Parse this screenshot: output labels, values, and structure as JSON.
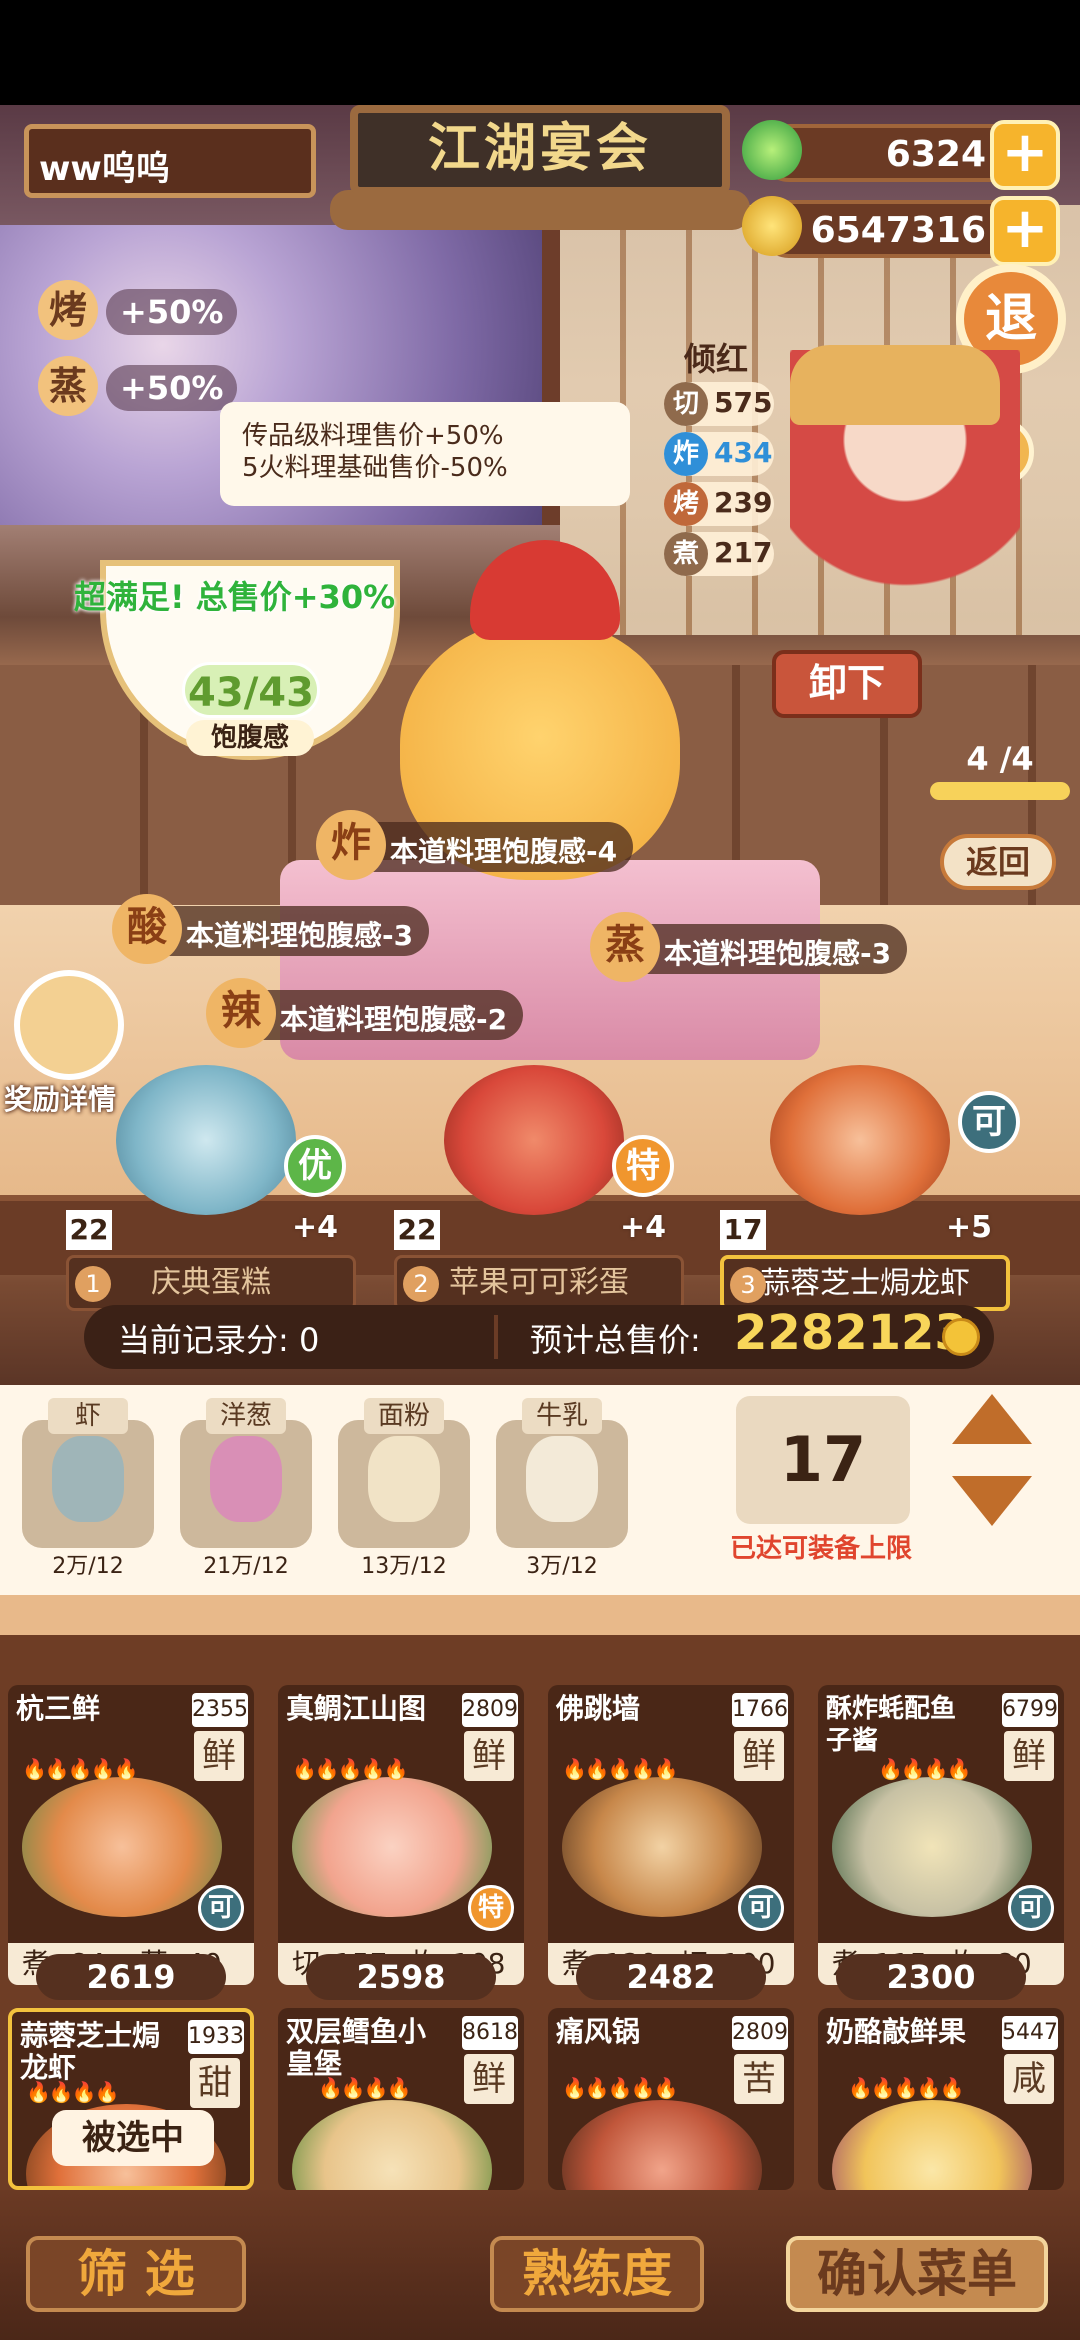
{
  "player": {
    "name": "ww呜呜"
  },
  "banquet": {
    "title": "江湖宴会"
  },
  "currency": {
    "jade": "6324",
    "coins": "6547316",
    "jade_icon": "jade-icon",
    "coin_icon": "coin-icon"
  },
  "buffs": [
    {
      "char": "烤",
      "text": "+50%"
    },
    {
      "char": "蒸",
      "text": "+50%"
    }
  ],
  "exit_label": "退",
  "help_label": "?",
  "tooltip": {
    "line1": "传品级料理售价+50%",
    "line2": "5火料理基础售价-50%"
  },
  "guest": {
    "name": "倾红",
    "stats": [
      {
        "char": "切",
        "value": "575",
        "color": "#8f6a4c"
      },
      {
        "char": "炸",
        "value": "434",
        "color": "#2f8fd8"
      },
      {
        "char": "烤",
        "value": "239",
        "color": "#c0683a"
      },
      {
        "char": "煮",
        "value": "217",
        "color": "#8f6a4c"
      }
    ]
  },
  "unload_label": "卸下",
  "progress": {
    "label": "4 /4",
    "fraction": 1.0
  },
  "back_label": "返回",
  "satisfaction": {
    "text": "超满足!  总售价+30%",
    "fullness": "43/43",
    "fullness_label": "饱腹感"
  },
  "debuffs": [
    {
      "char": "炸",
      "text": "本道料理饱腹感-4"
    },
    {
      "char": "酸",
      "text": "本道料理饱腹感-3"
    },
    {
      "char": "蒸",
      "text": "本道料理饱腹感-3"
    },
    {
      "char": "辣",
      "text": "本道料理饱腹感-2"
    }
  ],
  "reward_label": "奖励详情",
  "selected_dishes": [
    {
      "index": "1",
      "name": "庆典蛋糕",
      "level": "22",
      "bonus": "+4",
      "tag": "优",
      "tag_color": "#5db648",
      "img_color": "#7fb6c8"
    },
    {
      "index": "2",
      "name": "苹果可可彩蛋",
      "level": "22",
      "bonus": "+4",
      "tag": "特",
      "tag_color": "#f0962e",
      "img_color": "#d9483a"
    },
    {
      "index": "3",
      "name": "蒜蓉芝士焗龙虾",
      "level": "17",
      "bonus": "+5",
      "tag": "可",
      "tag_color": "#3d6f7c",
      "img_color": "#e0703a"
    }
  ],
  "score": {
    "current_label": "当前记录分:",
    "current_value": "0",
    "total_label": "预计总售价:",
    "total_value": "2282123"
  },
  "ingredients": [
    {
      "name": "虾",
      "qty": "2万/12",
      "color": "#9fb5b8"
    },
    {
      "name": "洋葱",
      "qty": "21万/12",
      "color": "#d98fb6"
    },
    {
      "name": "面粉",
      "qty": "13万/12",
      "color": "#f1e3c6"
    },
    {
      "name": "牛乳",
      "qty": "3万/12",
      "color": "#f3ead8"
    }
  ],
  "capacity": {
    "value": "17",
    "label": "已达可装备上限"
  },
  "menu": [
    {
      "name": "杭三鲜",
      "price": "2355",
      "taste": "鲜",
      "fire": "🔥🔥🔥🔥🔥",
      "badge": "可",
      "badge_color": "#3d6f7c",
      "skill1": "煮",
      "val1": "84",
      "skill2": "蒸",
      "val2": "40",
      "sell": "2619",
      "img": "#e38a4a"
    },
    {
      "name": "真鲷江山图",
      "price": "2809",
      "taste": "鲜",
      "fire": "🔥🔥🔥🔥🔥",
      "badge": "特",
      "badge_color": "#f0962e",
      "skill1": "切",
      "val1": "157",
      "skill2": "炸",
      "val2": "108",
      "sell": "2598",
      "img": "#f2a48e"
    },
    {
      "name": "佛跳墙",
      "price": "1766",
      "taste": "鲜",
      "fire": "🔥🔥🔥🔥🔥",
      "badge": "可",
      "badge_color": "#3d6f7c",
      "skill1": "煮",
      "val1": "120",
      "skill2": "切",
      "val2": "100",
      "sell": "2482",
      "img": "#c7874a"
    },
    {
      "name": "酥炸蚝配鱼子酱",
      "price": "6799",
      "taste": "鲜",
      "fire": "🔥🔥🔥🔥",
      "badge": "可",
      "badge_color": "#3d6f7c",
      "skill1": "煮",
      "val1": "115",
      "skill2": "炸",
      "val2": "80",
      "sell": "2300",
      "img": "#c7c1a4"
    },
    {
      "name": "蒜蓉芝士焗龙虾",
      "price": "1933",
      "taste": "甜",
      "fire": "🔥🔥🔥🔥",
      "img": "#e0703a"
    },
    {
      "name": "双层鳕鱼小皇堡",
      "price": "8618",
      "taste": "鲜",
      "fire": "🔥🔥🔥🔥",
      "img": "#e8c48a"
    },
    {
      "name": "痛风锅",
      "price": "2809",
      "taste": "苦",
      "fire": "🔥🔥🔥🔥🔥",
      "img": "#c0563a"
    },
    {
      "name": "奶酪敲鲜果",
      "price": "5447",
      "taste": "咸",
      "fire": "🔥🔥🔥🔥🔥",
      "img": "#f1c45a"
    }
  ],
  "selected_label": "被选中",
  "bottom": {
    "filter": "筛  选",
    "proficiency": "熟练度",
    "confirm": "确认菜单"
  }
}
